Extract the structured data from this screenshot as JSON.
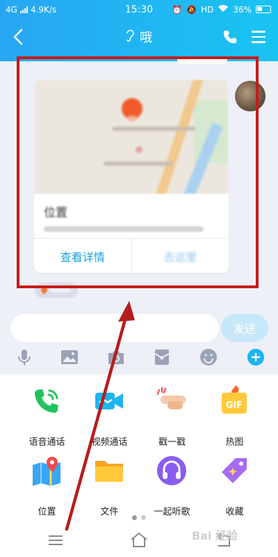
{
  "status_bar": {
    "network": "4G",
    "speed": "4.9K/s",
    "time": "15:30",
    "hd": "HD",
    "battery": "36%"
  },
  "nav": {
    "title": "哦"
  },
  "message_card": {
    "title": "位置",
    "actions": {
      "details": "查看详情",
      "go_here": "去这里"
    }
  },
  "input": {
    "value": "",
    "send_label": "发送"
  },
  "panel": {
    "apps": [
      {
        "label": "语音通话",
        "icon": "phone-call-icon"
      },
      {
        "label": "视频通话",
        "icon": "video-call-icon"
      },
      {
        "label": "戳一戳",
        "icon": "poke-hand-icon"
      },
      {
        "label": "热图",
        "icon": "gif-icon"
      },
      {
        "label": "位置",
        "icon": "map-location-icon"
      },
      {
        "label": "文件",
        "icon": "folder-icon"
      },
      {
        "label": "一起听歌",
        "icon": "headphones-icon"
      },
      {
        "label": "收藏",
        "icon": "favorites-tag-icon"
      }
    ],
    "page_count": 2,
    "active_page": 1
  },
  "watermark": "Bai 经验",
  "colors": {
    "header_start": "#28a6f2",
    "header_end": "#19c4f2",
    "accent": "#1a9fe0",
    "highlight": "#c81a1a"
  }
}
